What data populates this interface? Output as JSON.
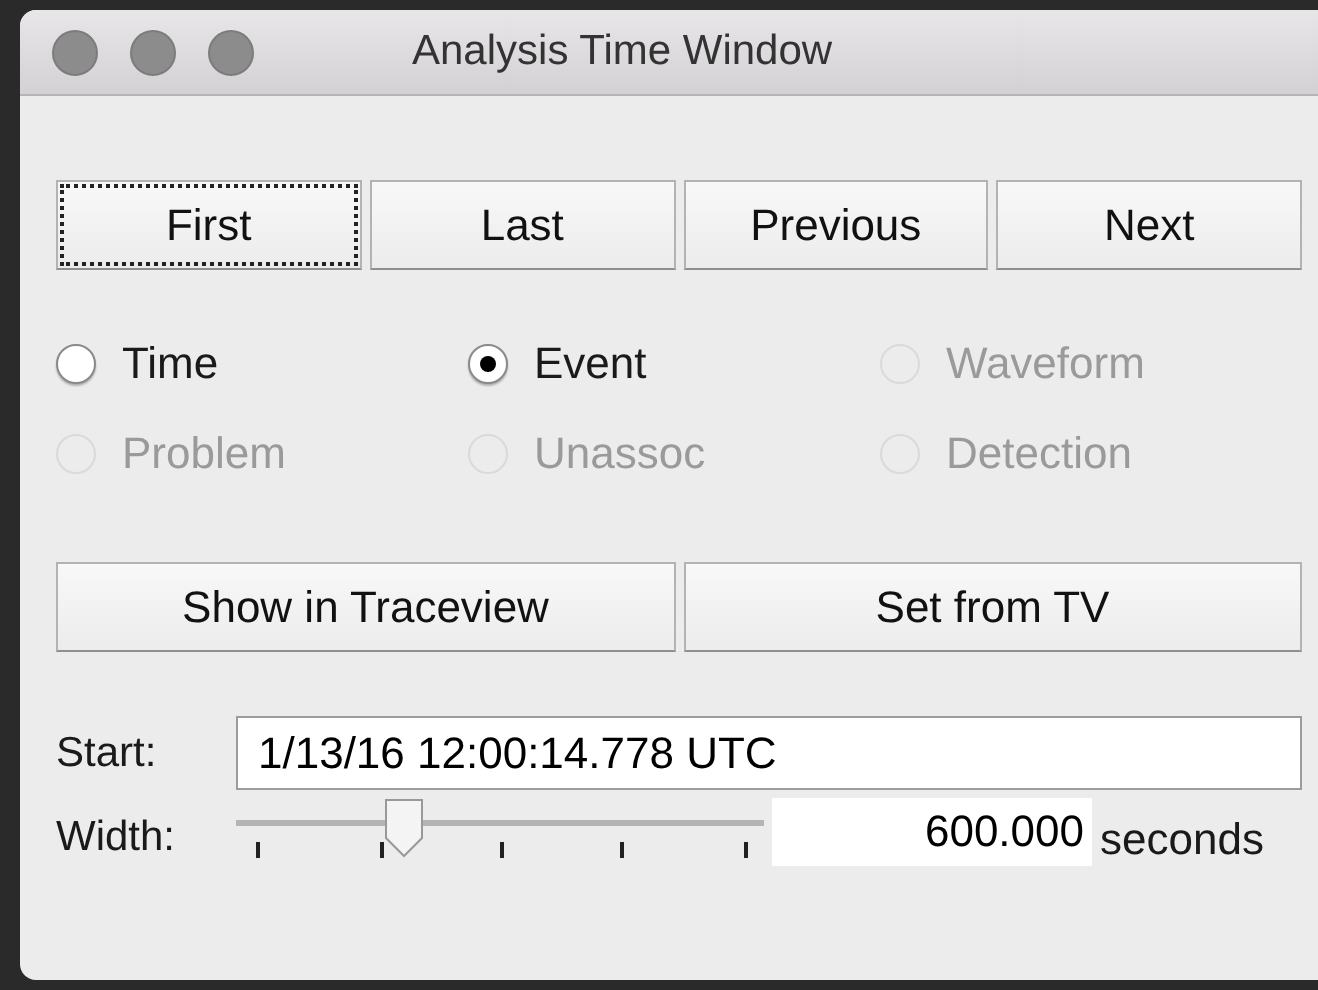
{
  "window": {
    "title": "Analysis Time Window"
  },
  "nav_buttons": [
    {
      "label": "First",
      "focused": true
    },
    {
      "label": "Last",
      "focused": false
    },
    {
      "label": "Previous",
      "focused": false
    },
    {
      "label": "Next",
      "focused": false
    }
  ],
  "modes": [
    {
      "label": "Time",
      "selected": false,
      "disabled": false
    },
    {
      "label": "Event",
      "selected": true,
      "disabled": false
    },
    {
      "label": "Waveform",
      "selected": false,
      "disabled": true
    },
    {
      "label": "Problem",
      "selected": false,
      "disabled": true
    },
    {
      "label": "Unassoc",
      "selected": false,
      "disabled": true
    },
    {
      "label": "Detection",
      "selected": false,
      "disabled": true
    }
  ],
  "actions": [
    "Show in Traceview",
    "Set from TV"
  ],
  "start": {
    "label": "Start:",
    "value": "1/13/16 12:00:14.778 UTC"
  },
  "width": {
    "label": "Width:",
    "level": 0.32,
    "value": "600.000",
    "unit": "seconds"
  }
}
